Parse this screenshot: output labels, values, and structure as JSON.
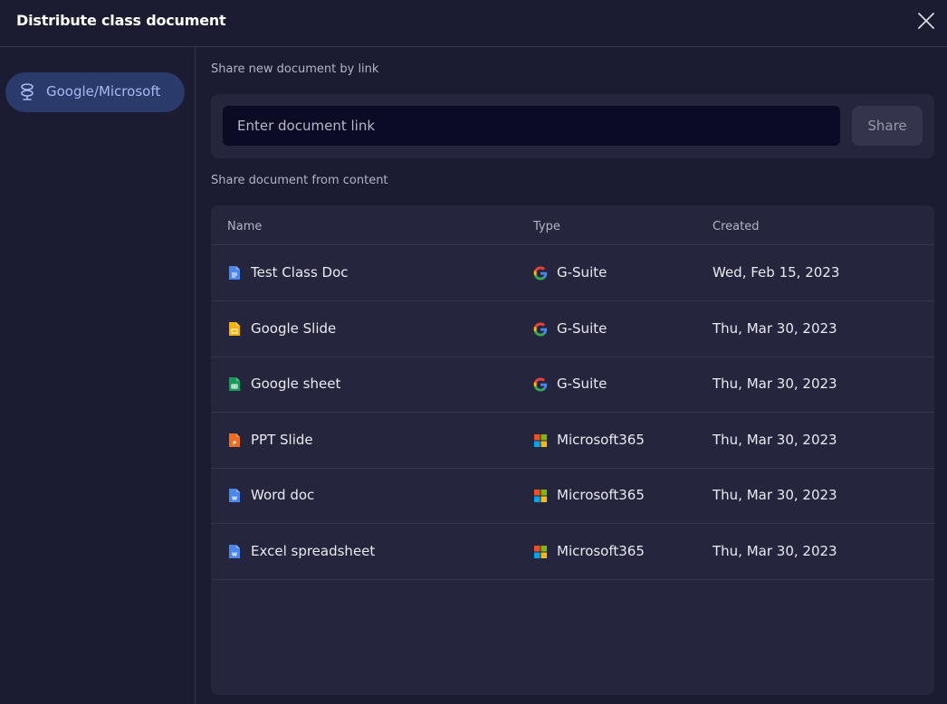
{
  "dialog": {
    "title": "Distribute class document"
  },
  "sidebar": {
    "items": [
      {
        "label": "Google/Microsoft",
        "icon": "provider-icon"
      }
    ]
  },
  "share_link": {
    "section_label": "Share new document by link",
    "input_placeholder": "Enter document link",
    "input_value": "",
    "button_label": "Share"
  },
  "content": {
    "section_label": "Share document from content",
    "columns": [
      "Name",
      "Type",
      "Created"
    ],
    "rows": [
      {
        "name": "Test Class Doc",
        "file_icon": "google-docs-icon",
        "file_color": "#4a86f0",
        "type": "G-Suite",
        "type_icon": "google-icon",
        "created": "Wed, Feb 15, 2023"
      },
      {
        "name": "Google Slide",
        "file_icon": "google-slides-icon",
        "file_color": "#f4b400",
        "type": "G-Suite",
        "type_icon": "google-icon",
        "created": "Thu, Mar 30, 2023"
      },
      {
        "name": "Google sheet",
        "file_icon": "google-sheets-icon",
        "file_color": "#0f9d58",
        "type": "G-Suite",
        "type_icon": "google-icon",
        "created": "Thu, Mar 30, 2023"
      },
      {
        "name": "PPT Slide",
        "file_icon": "powerpoint-icon",
        "file_color": "#f26b1d",
        "type": "Microsoft365",
        "type_icon": "microsoft-icon",
        "created": "Thu, Mar 30, 2023"
      },
      {
        "name": "Word doc",
        "file_icon": "word-icon",
        "file_color": "#4a86f0",
        "type": "Microsoft365",
        "type_icon": "microsoft-icon",
        "created": "Thu, Mar 30, 2023"
      },
      {
        "name": "Excel spreadsheet",
        "file_icon": "excel-icon",
        "file_color": "#4a86f0",
        "type": "Microsoft365",
        "type_icon": "microsoft-icon",
        "created": "Thu, Mar 30, 2023"
      }
    ]
  },
  "colors": {
    "background": "#1b1b32",
    "panel": "#25253d",
    "input_bg": "#0b0b26",
    "active_item_bg": "#2a3a6a",
    "active_item_text": "#a9b8f2"
  }
}
